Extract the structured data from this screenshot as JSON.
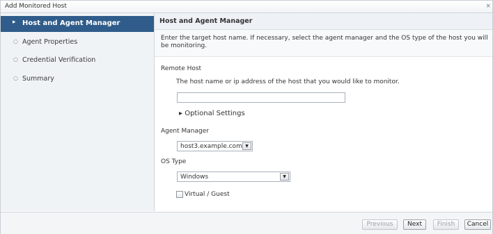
{
  "dialog": {
    "title": "Add Monitored Host"
  },
  "sidebar": {
    "steps": [
      {
        "label": "Host and Agent Manager",
        "bullet": "▸"
      },
      {
        "label": "Agent Properties",
        "bullet": "○"
      },
      {
        "label": "Credential Verification",
        "bullet": "○"
      },
      {
        "label": "Summary",
        "bullet": "○"
      }
    ]
  },
  "content": {
    "header": "Host and Agent Manager",
    "description": "Enter the target host name. If necessary, select the agent manager and the OS type of the host you will be monitoring.",
    "remote_host": {
      "label": "Remote Host",
      "help": "The host name or ip address of the host that you would like to monitor.",
      "value": ""
    },
    "optional_settings": "▸ Optional Settings",
    "agent_manager": {
      "label": "Agent Manager",
      "value": "host3.example.com"
    },
    "os_type": {
      "label": "OS Type",
      "value": "Windows"
    },
    "virtual_guest": {
      "label": "Virtual / Guest",
      "checked": false
    }
  },
  "footer": {
    "previous": "Previous",
    "next": "Next",
    "finish": "Finish",
    "cancel": "Cancel"
  }
}
